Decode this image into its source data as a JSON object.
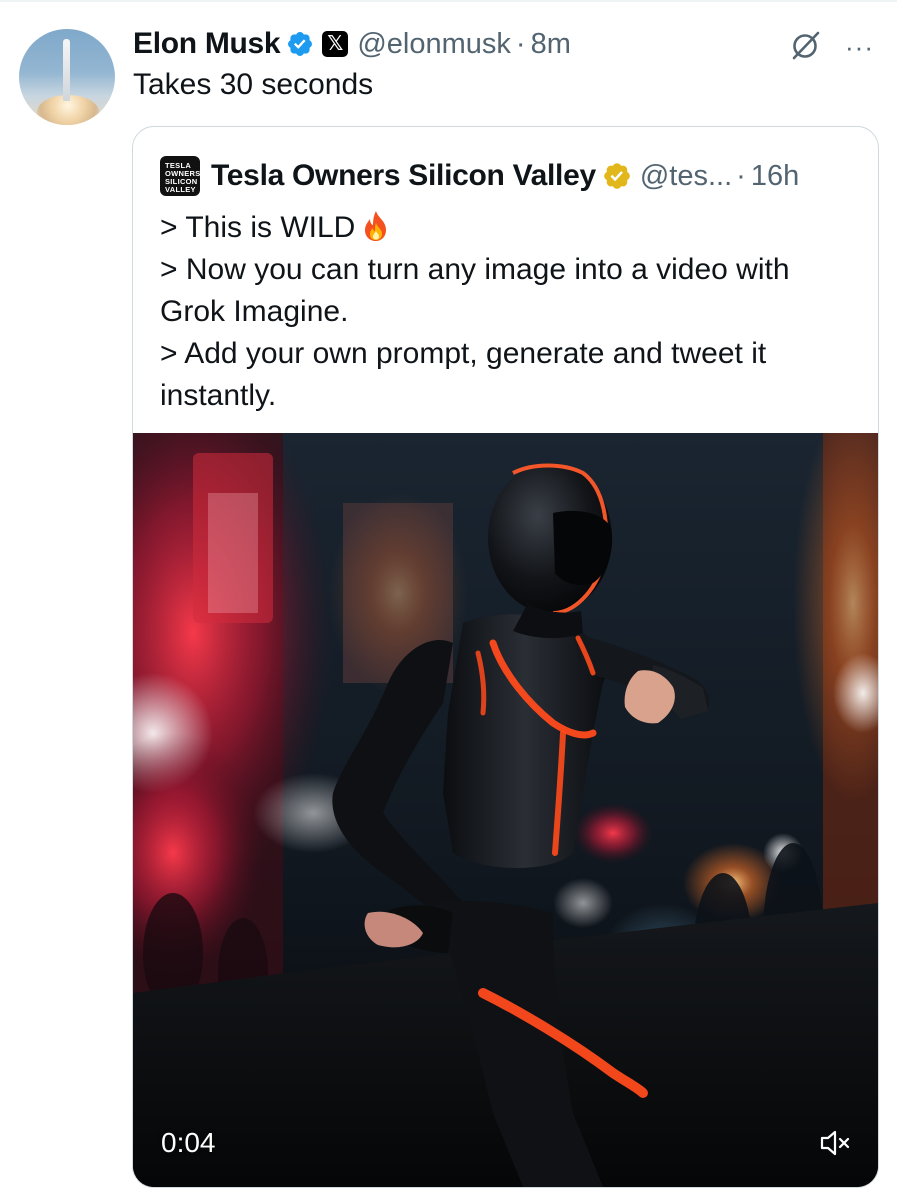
{
  "tweet": {
    "author_name": "Elon Musk",
    "author_handle": "@elonmusk",
    "separator": "·",
    "time": "8m",
    "text": "Takes 30 seconds",
    "avatar_icon": "rocket-launch-avatar",
    "verified_icon": "verified-blue-badge",
    "affiliation_icon": "x-logo-badge",
    "grok_icon": "grok-icon",
    "more_icon": "more-horizontal-icon",
    "more_glyph": "···"
  },
  "quote": {
    "avatar_lines": [
      "TESLA",
      "OWNERS",
      "SILICON",
      "VALLEY"
    ],
    "author_name": "Tesla Owners Silicon Valley",
    "author_handle": "@tes...",
    "separator": "·",
    "time": "16h",
    "verified_icon": "verified-gold-badge",
    "lines": [
      "> This is WILD",
      "> Now you can turn any image into a video with",
      "Grok Imagine.",
      "> Add your own prompt, generate and tweet it",
      "instantly."
    ],
    "emoji": "fire-icon",
    "video": {
      "timestamp": "0:04",
      "mute_icon": "volume-muted-icon"
    }
  },
  "colors": {
    "text_primary": "#0f1419",
    "text_secondary": "#536471",
    "border": "#cfd9de",
    "verified_blue": "#1d9bf0",
    "verified_gold": "#e2b719",
    "neon_orange": "#ff4a1c"
  }
}
